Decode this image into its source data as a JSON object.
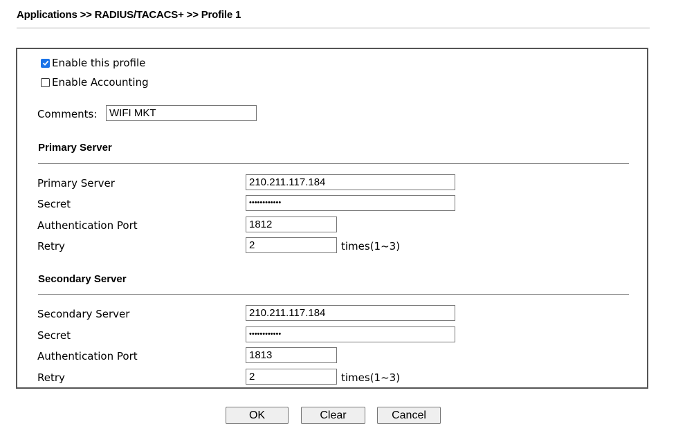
{
  "breadcrumb": "Applications >> RADIUS/TACACS+ >> Profile 1",
  "profile": {
    "enable_profile": {
      "label": "Enable this profile",
      "checked": true
    },
    "enable_accounting": {
      "label": "Enable Accounting",
      "checked": false
    },
    "comments": {
      "label": "Comments:",
      "value": "WIFI MKT"
    }
  },
  "primary": {
    "section_title": "Primary Server",
    "server_label": "Primary Server",
    "server_value": "210.211.117.184",
    "secret_label": "Secret",
    "secret_value": "••••••••••••",
    "port_label": "Authentication Port",
    "port_value": "1812",
    "retry_label": "Retry",
    "retry_value": "2",
    "retry_unit": "times(1~3)"
  },
  "secondary": {
    "section_title": "Secondary Server",
    "server_label": "Secondary Server",
    "server_value": "210.211.117.184",
    "secret_label": "Secret",
    "secret_value": "••••••••••••",
    "port_label": "Authentication Port",
    "port_value": "1813",
    "retry_label": "Retry",
    "retry_value": "2",
    "retry_unit": "times(1~3)"
  },
  "buttons": {
    "ok": "OK",
    "clear": "Clear",
    "cancel": "Cancel"
  },
  "colors": {
    "checkbox_checked": "#1a73e8"
  }
}
